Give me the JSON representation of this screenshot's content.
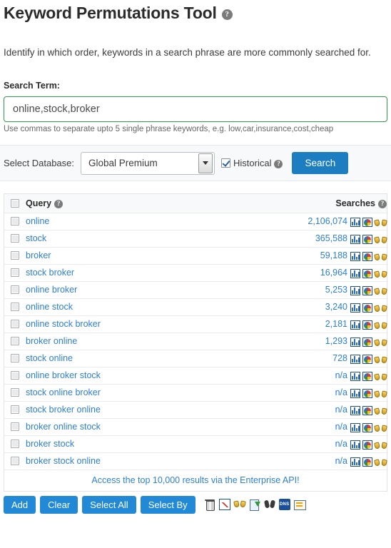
{
  "header": {
    "title": "Keyword Permutations Tool",
    "help_icon": "help-circle-icon",
    "subtitle": "Identify in which order, keywords in a search phrase are more commonly searched for."
  },
  "search_term": {
    "label": "Search Term:",
    "value": "online,stock,broker",
    "placeholder": "",
    "hint": "Use commas to separate upto 5 single phrase keywords, e.g. low,car,insurance,cost,cheap"
  },
  "database_bar": {
    "label": "Select Database:",
    "selected": "Global Premium",
    "options": [
      "Global Premium"
    ],
    "historical_label": "Historical",
    "historical_checked": true,
    "search_button": "Search"
  },
  "table": {
    "headers": {
      "query": "Query",
      "searches": "Searches"
    },
    "row_icons": [
      "bar-chart-icon",
      "pie-chart-icon",
      "binoculars-icon"
    ],
    "rows": [
      {
        "query": "online",
        "searches": "2,106,074"
      },
      {
        "query": "stock",
        "searches": "365,588"
      },
      {
        "query": "broker",
        "searches": "59,188"
      },
      {
        "query": "stock broker",
        "searches": "16,964"
      },
      {
        "query": "online broker",
        "searches": "5,253"
      },
      {
        "query": "online stock",
        "searches": "3,240"
      },
      {
        "query": "online stock broker",
        "searches": "2,181"
      },
      {
        "query": "broker online",
        "searches": "1,293"
      },
      {
        "query": "stock online",
        "searches": "728"
      },
      {
        "query": "online broker stock",
        "searches": "n/a"
      },
      {
        "query": "stock online broker",
        "searches": "n/a"
      },
      {
        "query": "stock broker online",
        "searches": "n/a"
      },
      {
        "query": "broker online stock",
        "searches": "n/a"
      },
      {
        "query": "broker stock",
        "searches": "n/a"
      },
      {
        "query": "broker stock online",
        "searches": "n/a"
      }
    ]
  },
  "api_promo": "Access the top 10,000 results via the Enterprise API!",
  "footer": {
    "buttons": [
      "Add",
      "Clear",
      "Select All",
      "Select By"
    ],
    "tool_icons": [
      "trash-icon",
      "line-chart-icon",
      "binoculars-icon",
      "export-page-icon",
      "find-binoculars-icon",
      "dns-icon",
      "report-list-icon"
    ],
    "dns_label": "DNS"
  },
  "colors": {
    "link": "#2d7fd4",
    "primary_button": "#1c7ec0",
    "flat_button": "#2289d6",
    "input_border_valid": "#2e9c4a",
    "bar_background": "#f8f9fa"
  }
}
